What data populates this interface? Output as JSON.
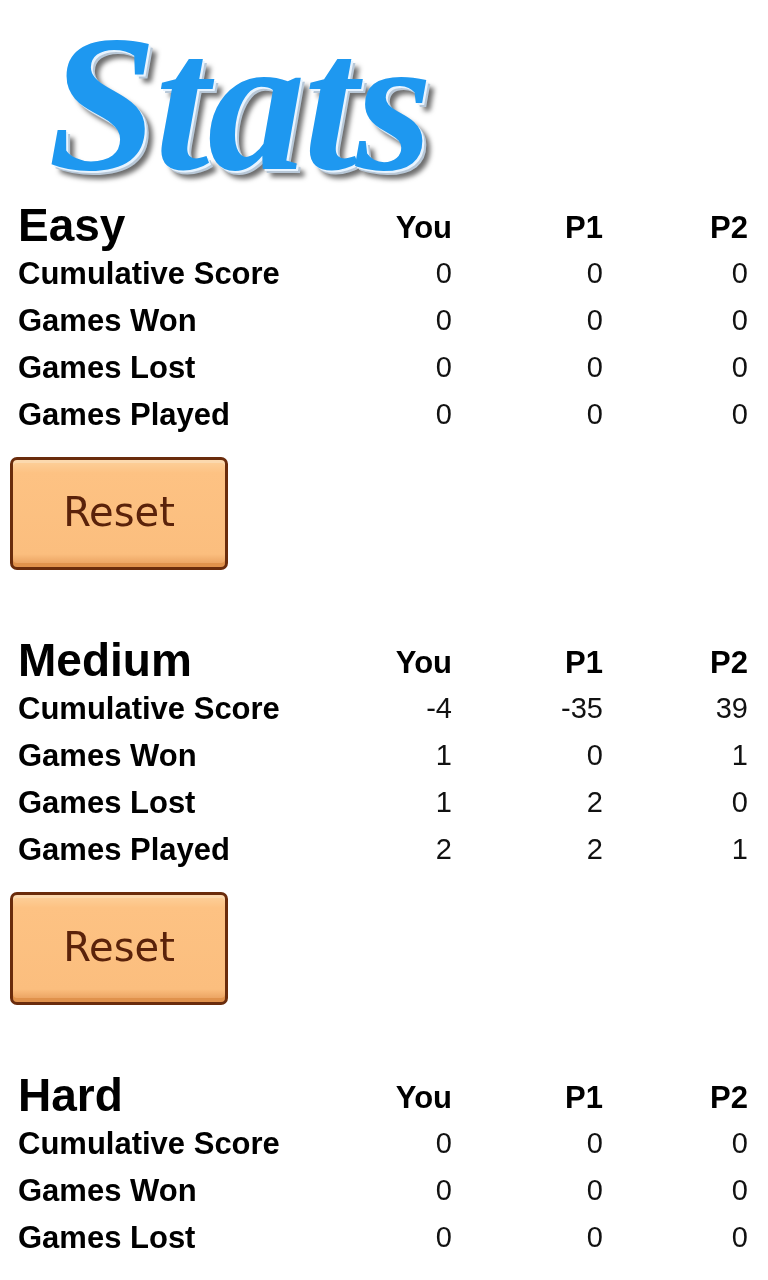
{
  "title": "Stats",
  "sections": [
    {
      "title": "Easy",
      "columns": [
        "You",
        "P1",
        "P2"
      ],
      "rows": [
        {
          "label": "Cumulative Score",
          "values": [
            "0",
            "0",
            "0"
          ]
        },
        {
          "label": "Games Won",
          "values": [
            "0",
            "0",
            "0"
          ]
        },
        {
          "label": "Games Lost",
          "values": [
            "0",
            "0",
            "0"
          ]
        },
        {
          "label": "Games Played",
          "values": [
            "0",
            "0",
            "0"
          ]
        }
      ],
      "button": "Reset"
    },
    {
      "title": "Medium",
      "columns": [
        "You",
        "P1",
        "P2"
      ],
      "rows": [
        {
          "label": "Cumulative Score",
          "values": [
            "-4",
            "-35",
            "39"
          ]
        },
        {
          "label": "Games Won",
          "values": [
            "1",
            "0",
            "1"
          ]
        },
        {
          "label": "Games Lost",
          "values": [
            "1",
            "2",
            "0"
          ]
        },
        {
          "label": "Games Played",
          "values": [
            "2",
            "2",
            "1"
          ]
        }
      ],
      "button": "Reset"
    },
    {
      "title": "Hard",
      "columns": [
        "You",
        "P1",
        "P2"
      ],
      "rows": [
        {
          "label": "Cumulative Score",
          "values": [
            "0",
            "0",
            "0"
          ]
        },
        {
          "label": "Games Won",
          "values": [
            "0",
            "0",
            "0"
          ]
        },
        {
          "label": "Games Lost",
          "values": [
            "0",
            "0",
            "0"
          ]
        }
      ]
    }
  ]
}
